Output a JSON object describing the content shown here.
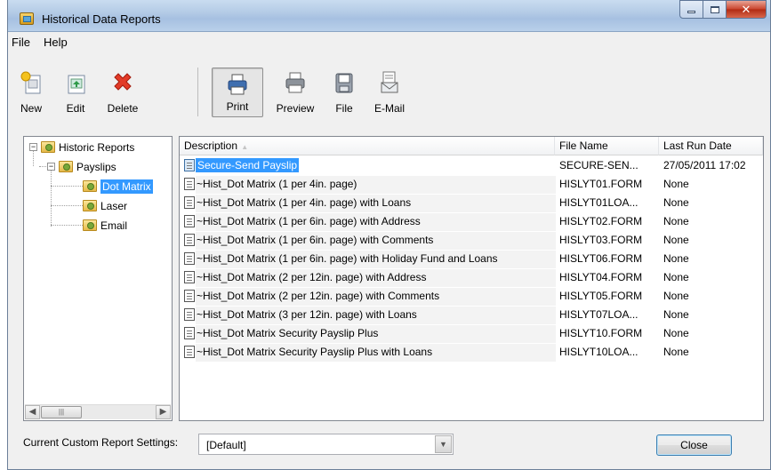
{
  "window": {
    "title": "Historical Data Reports"
  },
  "menu": [
    "File",
    "Help"
  ],
  "toolbar": [
    {
      "label": "New",
      "icon": "new-report-icon"
    },
    {
      "label": "Edit",
      "icon": "edit-report-icon"
    },
    {
      "label": "Delete",
      "icon": "delete-icon"
    },
    {
      "label": "Print",
      "icon": "printer-icon",
      "pressed": true
    },
    {
      "label": "Preview",
      "icon": "print-preview-icon"
    },
    {
      "label": "File",
      "icon": "floppy-disk-icon"
    },
    {
      "label": "E-Mail",
      "icon": "email-icon"
    }
  ],
  "tree": {
    "root": "Historic Reports",
    "child": "Payslips",
    "leaves": [
      "Dot Matrix",
      "Laser",
      "Email"
    ],
    "selected": "Dot Matrix"
  },
  "list": {
    "columns": [
      "Description",
      "File Name",
      "Last Run Date"
    ],
    "rows": [
      {
        "desc": "Secure-Send Payslip",
        "file": "SECURE-SEN...",
        "date": "27/05/2011 17:02",
        "selected": true
      },
      {
        "desc": "~Hist_Dot Matrix (1 per 4in. page)",
        "file": "HISLYT01.FORM",
        "date": "None"
      },
      {
        "desc": "~Hist_Dot Matrix (1 per 4in. page) with Loans",
        "file": "HISLYT01LOA...",
        "date": "None"
      },
      {
        "desc": "~Hist_Dot Matrix (1 per 6in. page) with Address",
        "file": "HISLYT02.FORM",
        "date": "None"
      },
      {
        "desc": "~Hist_Dot Matrix (1 per 6in. page) with Comments",
        "file": "HISLYT03.FORM",
        "date": "None"
      },
      {
        "desc": "~Hist_Dot Matrix (1 per 6in. page) with Holiday Fund and Loans",
        "file": "HISLYT06.FORM",
        "date": "None"
      },
      {
        "desc": "~Hist_Dot Matrix (2 per 12in. page) with Address",
        "file": "HISLYT04.FORM",
        "date": "None"
      },
      {
        "desc": "~Hist_Dot Matrix (2 per 12in. page) with Comments",
        "file": "HISLYT05.FORM",
        "date": "None"
      },
      {
        "desc": "~Hist_Dot Matrix (3 per 12in. page) with Loans",
        "file": "HISLYT07LOA...",
        "date": "None"
      },
      {
        "desc": "~Hist_Dot Matrix Security Payslip Plus",
        "file": "HISLYT10.FORM",
        "date": "None"
      },
      {
        "desc": "~Hist_Dot Matrix Security Payslip Plus with Loans",
        "file": "HISLYT10LOA...",
        "date": "None"
      }
    ]
  },
  "footer": {
    "settings_label": "Current Custom Report Settings:",
    "settings_value": "[Default]",
    "close_label": "Close"
  }
}
